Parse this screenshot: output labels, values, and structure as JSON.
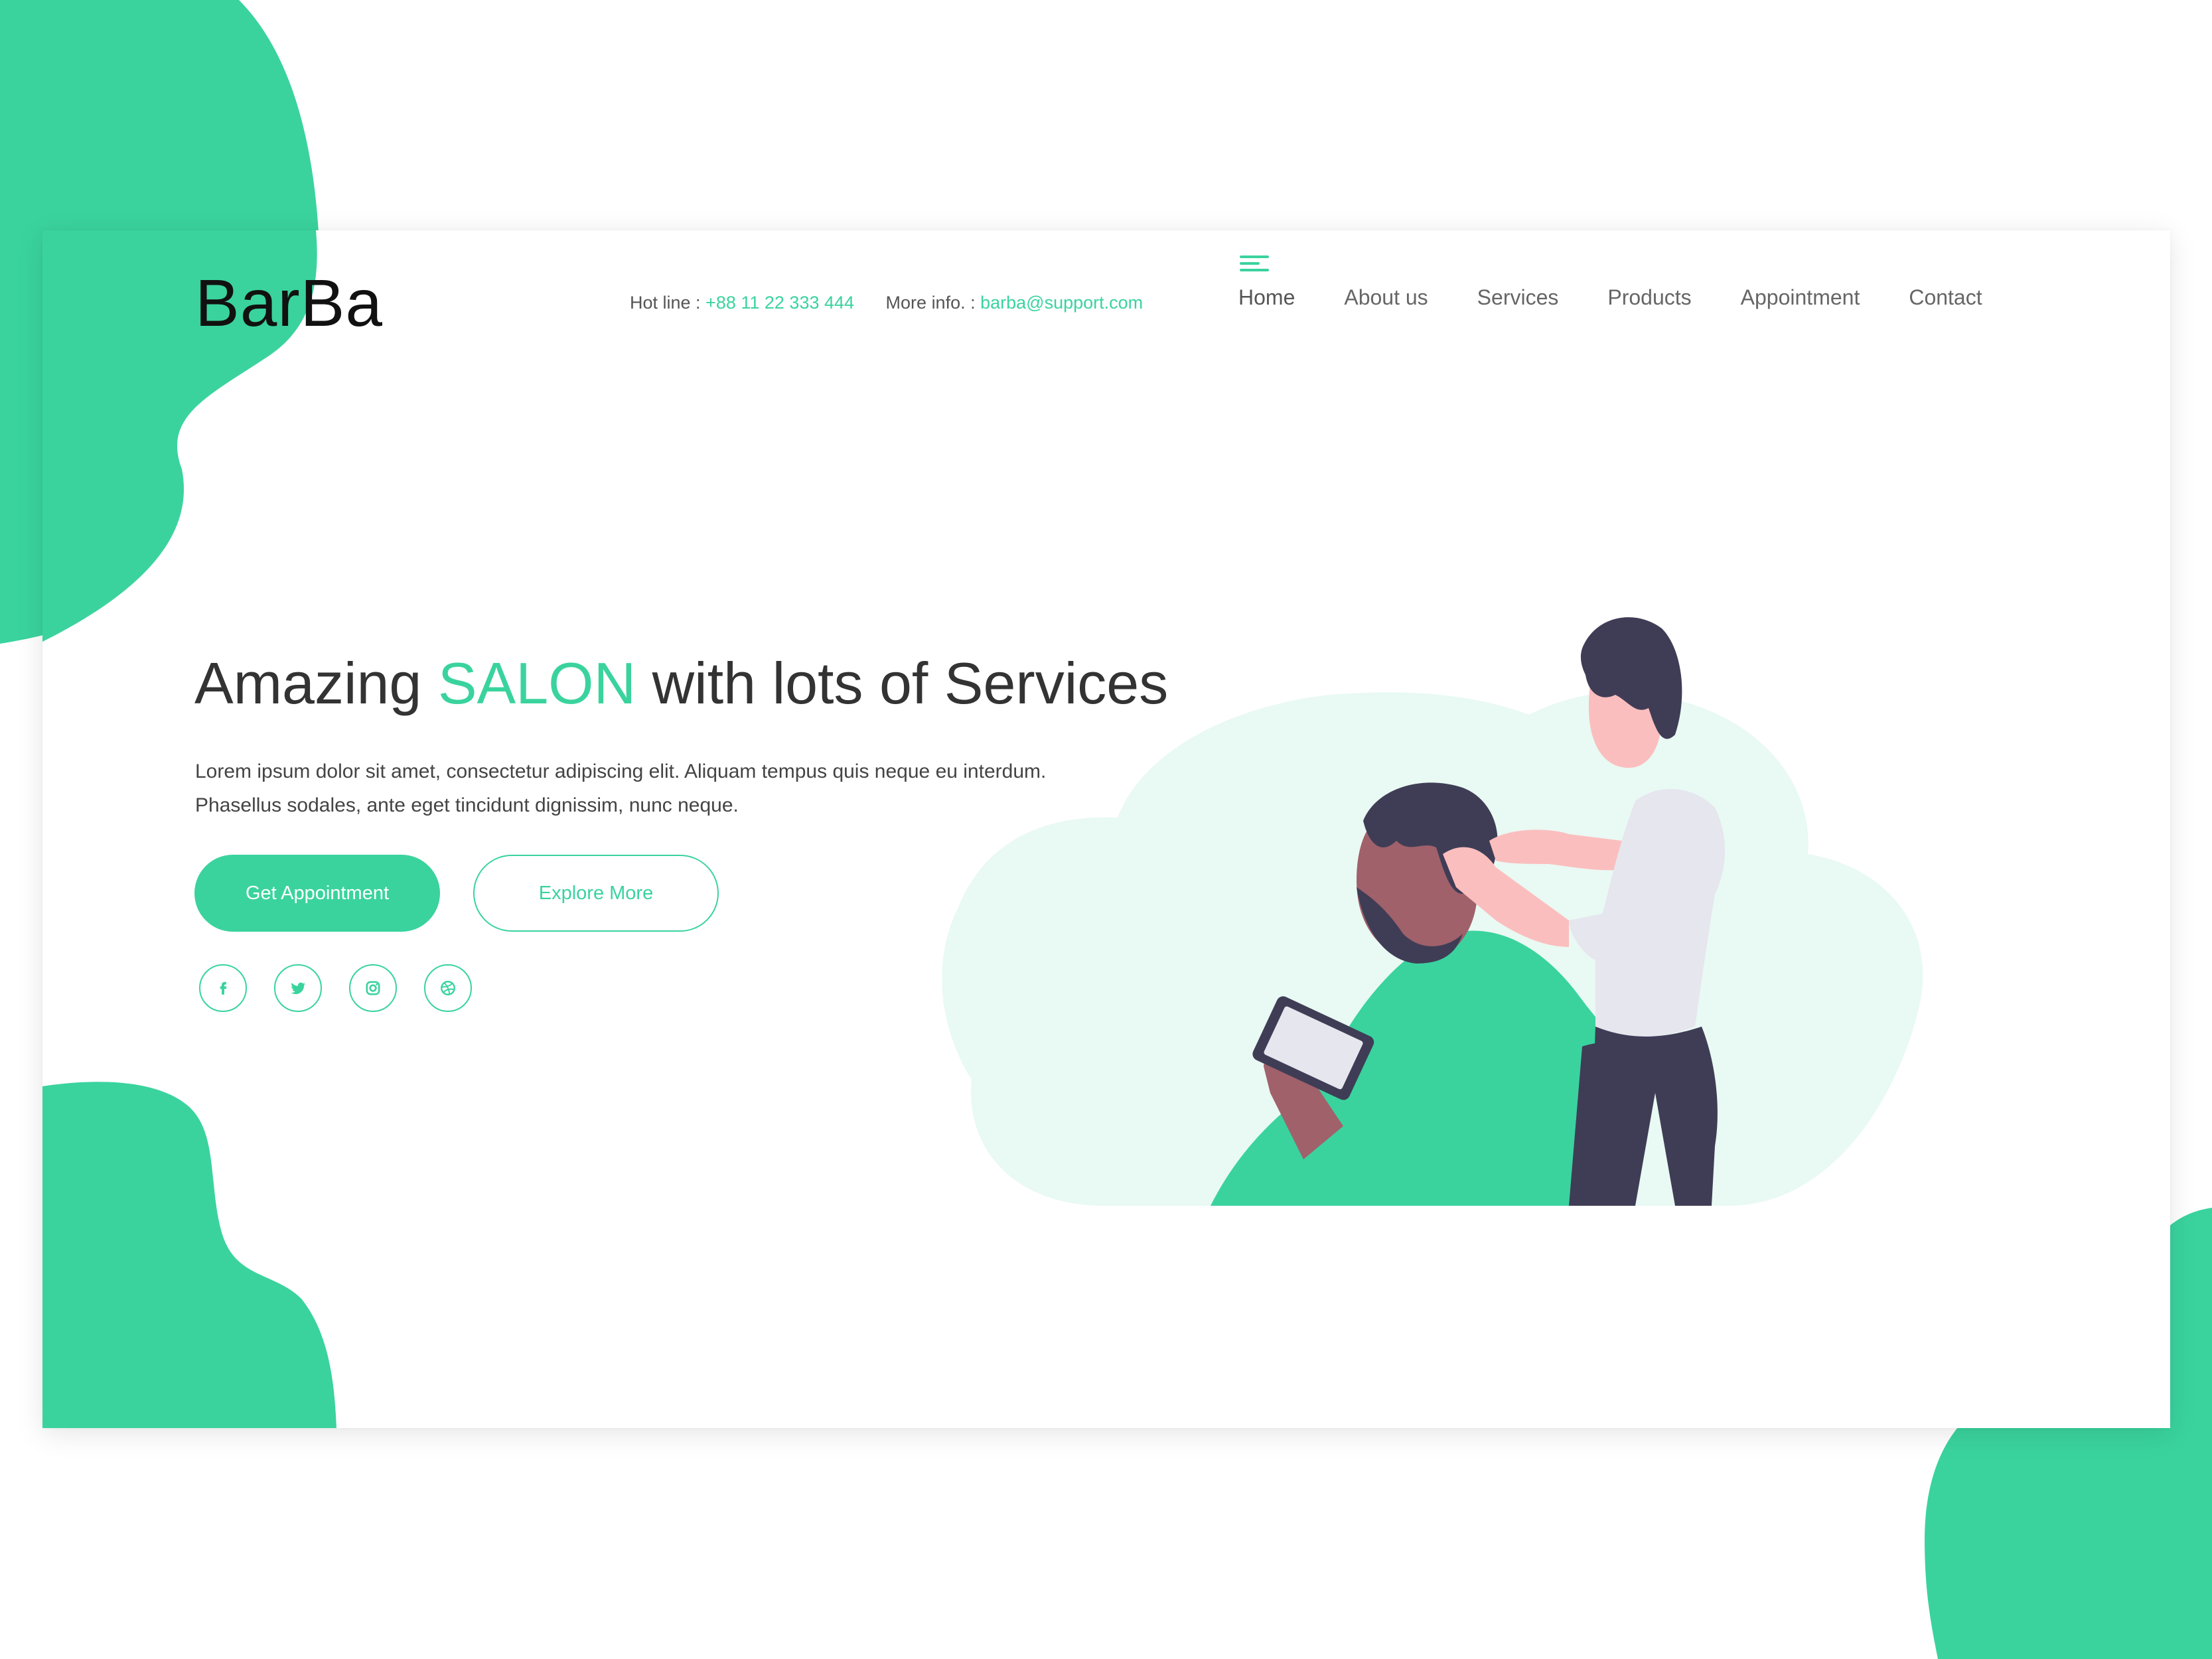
{
  "brand": {
    "logo": "BarBa"
  },
  "header": {
    "hotline_label": "Hot line : ",
    "hotline_value": "+88 11 22 333 444",
    "info_label": "More info. : ",
    "info_value": "barba@support.com"
  },
  "nav": {
    "items": [
      {
        "label": "Home",
        "active": true
      },
      {
        "label": "About us"
      },
      {
        "label": "Services"
      },
      {
        "label": "Products"
      },
      {
        "label": "Appointment"
      },
      {
        "label": "Contact"
      }
    ]
  },
  "hero": {
    "headline_before": "Amazing ",
    "headline_accent": "SALON",
    "headline_after": " with lots of Services",
    "description": "Lorem ipsum dolor sit amet, consectetur adipiscing elit. Aliquam tempus quis neque eu interdum. Phasellus sodales, ante eget tincidunt dignissim, nunc neque.",
    "primary_button": "Get Appointment",
    "secondary_button": "Explore More"
  },
  "social": [
    "facebook-icon",
    "twitter-icon",
    "instagram-icon",
    "dribbble-icon"
  ],
  "colors": {
    "accent": "#3ad39e",
    "illustration_bg": "#e9f9f3",
    "dark": "#3f3d56",
    "text": "#333333"
  }
}
